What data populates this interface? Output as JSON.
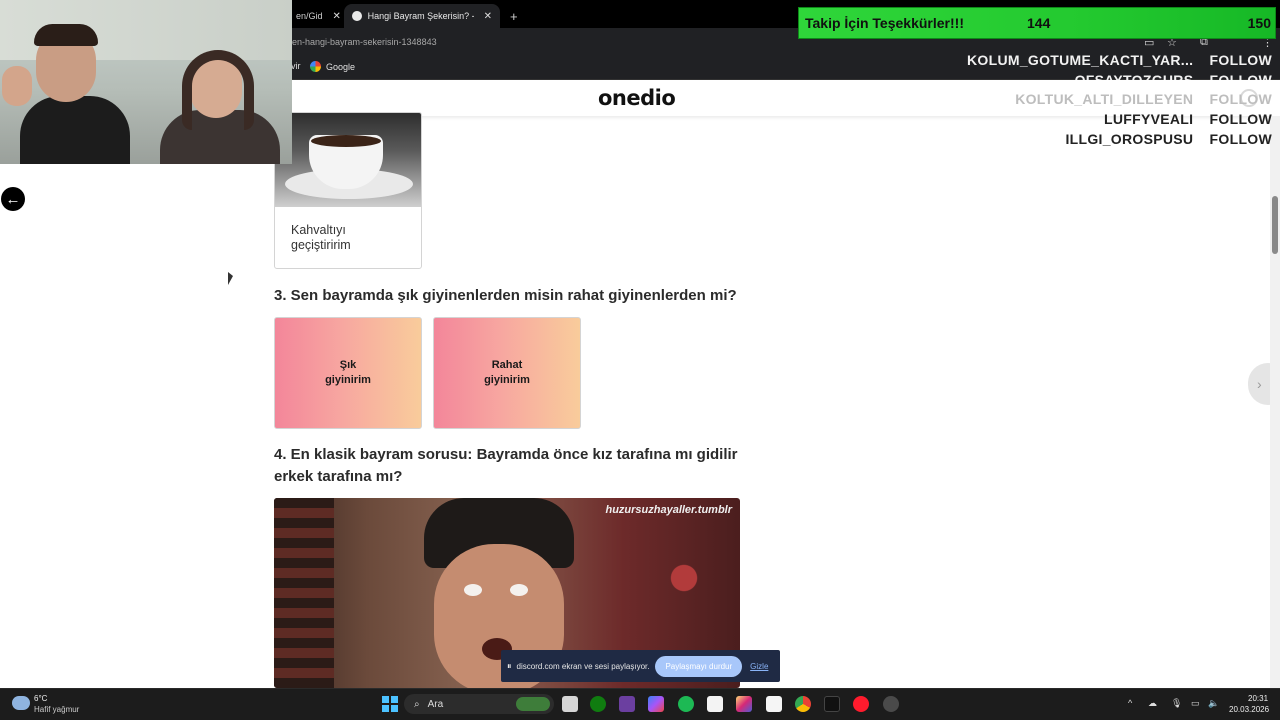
{
  "browser": {
    "tabs": [
      {
        "label": "en/Gid",
        "close": "✕"
      },
      {
        "label": "Hangi Bayram Şekerisin? - One",
        "close": "✕"
      }
    ],
    "new_tab": "+",
    "url": "en-hangi-bayram-sekerisin-1348843",
    "bookmark_partial": "vir",
    "bookmark_google": "Google"
  },
  "site": {
    "logo": "onedio"
  },
  "quiz": {
    "q2_option": "Kahvaltıyı geçiştiririm",
    "q3_title": "3. Sen bayramda şık giyinenlerden misin rahat giyinenlerden mi?",
    "q3_options": [
      "Şık giyinirim",
      "Rahat giyinirim"
    ],
    "q4_title": "4. En klasik bayram sorusu: Bayramda önce kız tarafına mı gidilir erkek tarafına mı?",
    "q4_watermark": "huzursuzhayaller.tumblr"
  },
  "overlay": {
    "follow_title": "Takip İçin Teşekkürler!!!",
    "follow_count": "144",
    "follow_goal": "150",
    "followers": [
      {
        "name": "KOLUM_GOTUME_KACTI_YAR...",
        "action": "FOLLOW"
      },
      {
        "name": "OFSAYTOZGURS",
        "action": "FOLLOW"
      },
      {
        "name": "KOLTUK_ALTI_DILLEYEN",
        "action": "FOLLOW"
      },
      {
        "name": "LUFFYVEALI",
        "action": "FOLLOW"
      },
      {
        "name": "ILLGI_OROSPUSU",
        "action": "FOLLOW"
      }
    ]
  },
  "discord": {
    "message": "discord.com ekran ve sesi paylaşıyor.",
    "stop_label": "Paylaşmayı durdur",
    "hide_label": "Gizle"
  },
  "taskbar": {
    "weather_temp": "6°C",
    "weather_desc": "Hafif yağmur",
    "search_label": "Ara",
    "time": "20:31",
    "date": "20.03.2026"
  },
  "colors": {
    "follow_bar": "#23c92f",
    "card_gradient_start": "#f3869a",
    "card_gradient_end": "#f9cc9b",
    "taskbar_bg": "#1c1c1c"
  }
}
